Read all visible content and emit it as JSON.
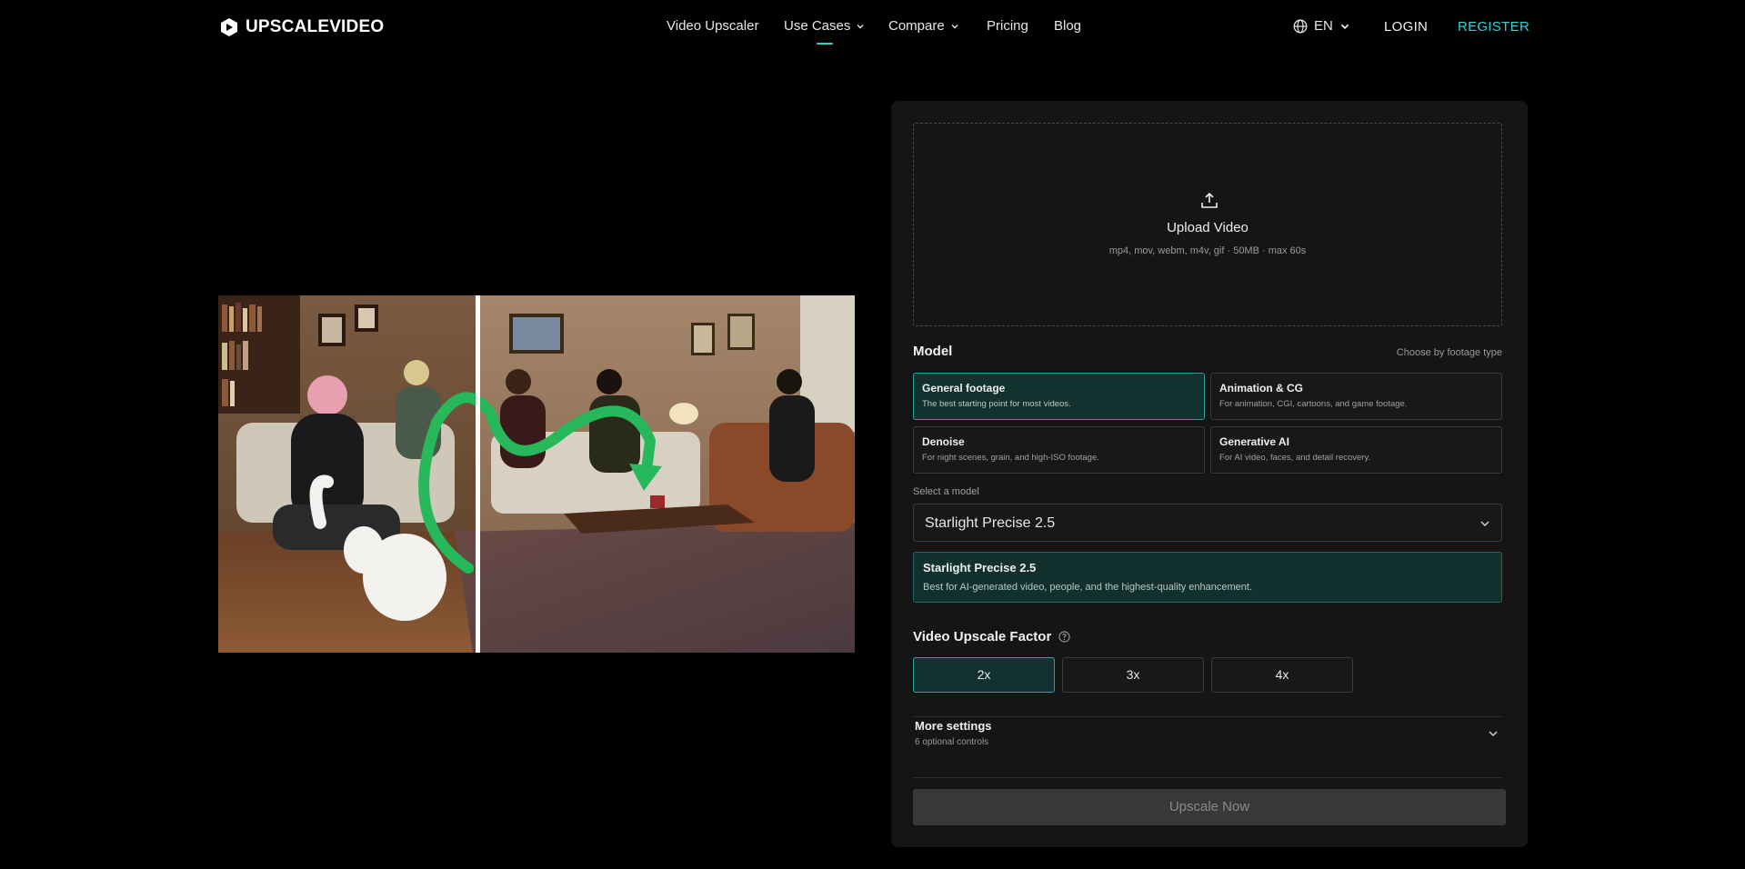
{
  "brand": {
    "name": "UPSCALEVIDEO",
    "accent": "#2fd3d3"
  },
  "nav": {
    "links": [
      {
        "label": "Video Upscaler",
        "dropdown": false
      },
      {
        "label": "Use Cases",
        "dropdown": true,
        "active": true
      },
      {
        "label": "Compare",
        "dropdown": true
      },
      {
        "label": "Pricing",
        "dropdown": false
      },
      {
        "label": "Blog",
        "dropdown": false
      }
    ],
    "language": "EN",
    "login": "LOGIN",
    "register": "REGISTER"
  },
  "preview": {
    "icons": {
      "split_handle": "comparison-slider"
    }
  },
  "upload": {
    "title": "Upload Video",
    "formats": "mp4, mov, webm, m4v, gif · 50MB · max 60s",
    "icon": "upload-icon"
  },
  "model": {
    "label": "Model",
    "hint": "Choose by footage type",
    "cards": [
      {
        "title": "General footage",
        "desc": "The best starting point for most videos.",
        "selected": true
      },
      {
        "title": "Animation & CG",
        "desc": "For animation, CGI, cartoons, and game footage.",
        "selected": false
      },
      {
        "title": "Denoise",
        "desc": "For night scenes, grain, and high-ISO footage.",
        "selected": false
      },
      {
        "title": "Generative AI",
        "desc": "For AI video, faces, and detail recovery.",
        "selected": false
      }
    ],
    "select_label": "Select a model",
    "selected": "Starlight Precise 2.5",
    "info_title": "Starlight Precise 2.5",
    "info_desc": "Best for AI-generated video, people, and the highest-quality enhancement."
  },
  "factor": {
    "label": "Video Upscale Factor",
    "options": [
      {
        "label": "2x",
        "selected": true
      },
      {
        "label": "3x",
        "selected": false
      },
      {
        "label": "4x",
        "selected": false
      }
    ]
  },
  "more_settings": {
    "title": "More settings",
    "subtitle": "6 optional controls"
  },
  "cta": {
    "label": "Upscale Now"
  }
}
